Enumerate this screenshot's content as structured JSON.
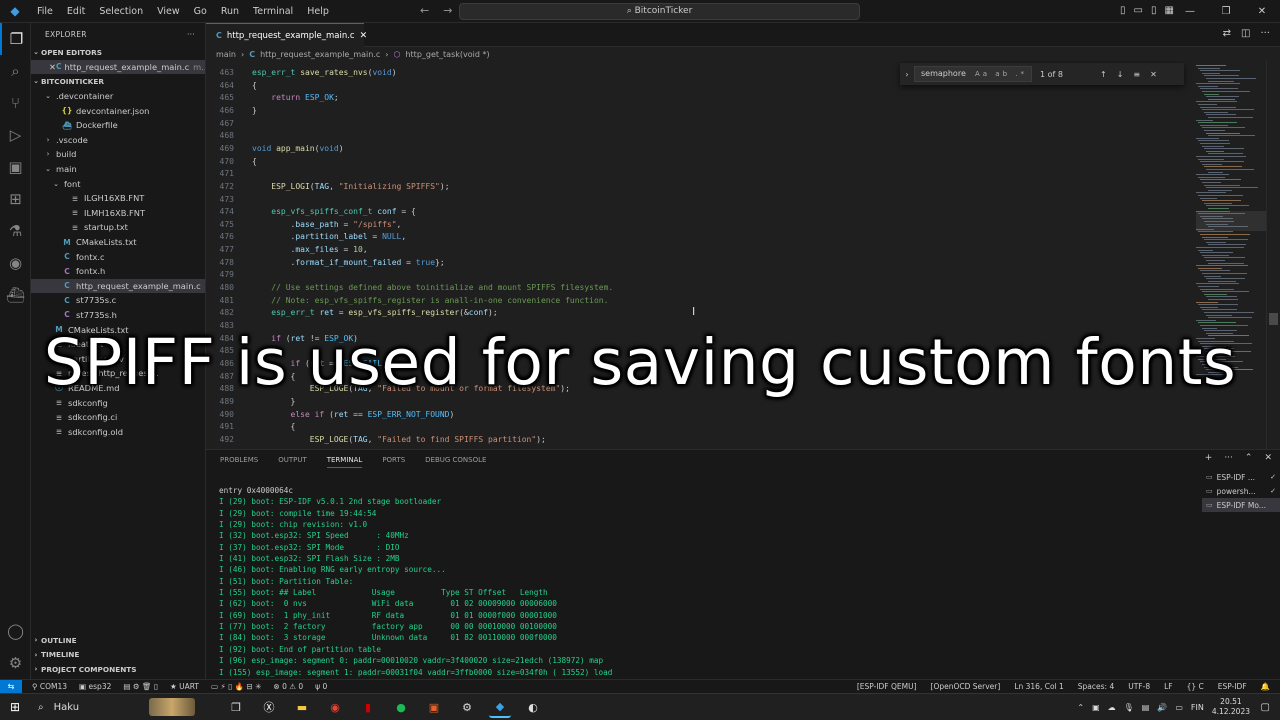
{
  "titlebar": {
    "menu": [
      "File",
      "Edit",
      "Selection",
      "View",
      "Go",
      "Run",
      "Terminal",
      "Help"
    ],
    "command_center": "BitcoinTicker"
  },
  "sidebar": {
    "title": "EXPLORER",
    "open_editors": "OPEN EDITORS",
    "open_editor_file": "http_request_example_main.c",
    "open_editor_suffix": "m...",
    "project": "BITCOINTICKER",
    "tree": [
      {
        "label": ".devcontainer",
        "type": "folder",
        "depth": 1,
        "open": true
      },
      {
        "label": "devcontainer.json",
        "type": "json",
        "depth": 2
      },
      {
        "label": "Dockerfile",
        "type": "docker",
        "depth": 2
      },
      {
        "label": ".vscode",
        "type": "folder",
        "depth": 1,
        "open": false
      },
      {
        "label": "build",
        "type": "folder",
        "depth": 1,
        "open": false
      },
      {
        "label": "main",
        "type": "folder",
        "depth": 1,
        "open": true
      },
      {
        "label": "font",
        "type": "folder",
        "depth": 2,
        "open": true
      },
      {
        "label": "ILGH16XB.FNT",
        "type": "txt",
        "depth": 3
      },
      {
        "label": "ILMH16XB.FNT",
        "type": "txt",
        "depth": 3
      },
      {
        "label": "startup.txt",
        "type": "txt",
        "depth": 3
      },
      {
        "label": "CMakeLists.txt",
        "type": "cmake",
        "depth": 2
      },
      {
        "label": "fontx.c",
        "type": "c",
        "depth": 2
      },
      {
        "label": "fontx.h",
        "type": "h",
        "depth": 2
      },
      {
        "label": "http_request_example_main.c",
        "type": "c",
        "depth": 2,
        "selected": true
      },
      {
        "label": "st7735s.c",
        "type": "c",
        "depth": 2
      },
      {
        "label": "st7735s.h",
        "type": "h",
        "depth": 2
      },
      {
        "label": "CMakeLists.txt",
        "type": "cmake",
        "depth": 1
      },
      {
        "label": "Ideat.txt",
        "type": "txt",
        "depth": 1
      },
      {
        "label": "partitions.csv",
        "type": "csv",
        "depth": 1
      },
      {
        "label": "pytest_http_request...",
        "type": "txt",
        "depth": 1
      },
      {
        "label": "README.md",
        "type": "md",
        "depth": 1
      },
      {
        "label": "sdkconfig",
        "type": "txt",
        "depth": 1
      },
      {
        "label": "sdkconfig.ci",
        "type": "txt",
        "depth": 1
      },
      {
        "label": "sdkconfig.old",
        "type": "txt",
        "depth": 1
      }
    ],
    "bottom_sections": [
      "OUTLINE",
      "TIMELINE",
      "PROJECT COMPONENTS"
    ]
  },
  "editor": {
    "tab_label": "http_request_example_main.c",
    "breadcrumb": [
      "main",
      "http_request_example_main.c",
      "http_get_task(void *)"
    ],
    "find": {
      "query": "semaphore",
      "count": "1 of 8",
      "options": "Aa ab .*"
    },
    "lines": [
      {
        "n": "463",
        "html": "<span class='ty'>esp_err_t</span> <span class='fn'>save_rates_nvs</span>(<span class='kw'>void</span>)"
      },
      {
        "n": "464",
        "html": "{"
      },
      {
        "n": "465",
        "html": "    <span class='ctl'>return</span> <span class='mac'>ESP_OK</span>;"
      },
      {
        "n": "466",
        "html": "}"
      },
      {
        "n": "467",
        "html": ""
      },
      {
        "n": "468",
        "html": ""
      },
      {
        "n": "469",
        "html": "<span class='kw'>void</span> <span class='fn'>app_main</span>(<span class='kw'>void</span>)"
      },
      {
        "n": "470",
        "html": "{"
      },
      {
        "n": "471",
        "html": ""
      },
      {
        "n": "472",
        "html": "    <span class='fn'>ESP_LOGI</span>(<span class='var'>TAG</span>, <span class='str'>\"Initializing SPIFFS\"</span>);"
      },
      {
        "n": "473",
        "html": ""
      },
      {
        "n": "474",
        "html": "    <span class='ty'>esp_vfs_spiffs_conf_t</span> <span class='var'>conf</span> = {"
      },
      {
        "n": "475",
        "html": "        .<span class='var'>base_path</span> = <span class='str'>\"/spiffs\"</span>,"
      },
      {
        "n": "476",
        "html": "        .<span class='var'>partition_label</span> = <span class='kw'>NULL</span>,"
      },
      {
        "n": "477",
        "html": "        .<span class='var'>max_files</span> = <span class='num'>10</span>,"
      },
      {
        "n": "478",
        "html": "        .<span class='var'>format_if_mount_failed</span> = <span class='kw'>true</span>};"
      },
      {
        "n": "479",
        "html": ""
      },
      {
        "n": "480",
        "html": "    <span class='cm'>// Use settings defined above toinitialize and mount SPIFFS filesystem.</span>"
      },
      {
        "n": "481",
        "html": "    <span class='cm'>// Note: esp_vfs_spiffs_register is anall-in-one convenience function.</span>"
      },
      {
        "n": "482",
        "html": "    <span class='ty'>esp_err_t</span> <span class='var'>ret</span> = <span class='fn'>esp_vfs_spiffs_register</span>(&amp;<span class='var'>conf</span>);"
      },
      {
        "n": "483",
        "html": ""
      },
      {
        "n": "484",
        "html": "    <span class='ctl'>if</span> (<span class='var'>ret</span> != <span class='mac'>ESP_OK</span>)"
      },
      {
        "n": "485",
        "html": "    {"
      },
      {
        "n": "486",
        "html": "        <span class='ctl'>if</span> (<span class='var'>ret</span> == <span class='mac'>ESP_FAIL</span>)"
      },
      {
        "n": "487",
        "html": "        {"
      },
      {
        "n": "488",
        "html": "            <span class='fn'>ESP_LOGE</span>(<span class='var'>TAG</span>, <span class='str'>\"Failed to mount or format filesystem\"</span>);"
      },
      {
        "n": "489",
        "html": "        }"
      },
      {
        "n": "490",
        "html": "        <span class='ctl'>else if</span> (<span class='var'>ret</span> == <span class='mac'>ESP_ERR_NOT_FOUND</span>)"
      },
      {
        "n": "491",
        "html": "        {"
      },
      {
        "n": "492",
        "html": "            <span class='fn'>ESP_LOGE</span>(<span class='var'>TAG</span>, <span class='str'>\"Failed to find SPIFFS partition\"</span>);"
      }
    ]
  },
  "panel": {
    "tabs": [
      "PROBLEMS",
      "OUTPUT",
      "TERMINAL",
      "PORTS",
      "DEBUG CONSOLE"
    ],
    "active_tab": "TERMINAL",
    "terminal_lines": [
      "entry 0x4000064c",
      "I (29) boot: ESP-IDF v5.0.1 2nd stage bootloader",
      "I (29) boot: compile time 19:44:54",
      "I (29) boot: chip revision: v1.0",
      "I (32) boot.esp32: SPI Speed      : 40MHz",
      "I (37) boot.esp32: SPI Mode       : DIO",
      "I (41) boot.esp32: SPI Flash Size : 2MB",
      "I (46) boot: Enabling RNG early entropy source...",
      "I (51) boot: Partition Table:",
      "I (55) boot: ## Label            Usage          Type ST Offset   Length",
      "I (62) boot:  0 nvs              WiFi data        01 02 00009000 00006000",
      "I (69) boot:  1 phy_init         RF data          01 01 0000f000 00001000",
      "I (77) boot:  2 factory          factory app      00 00 00010000 00100000",
      "I (84) boot:  3 storage          Unknown data     01 82 00110000 000f0000",
      "I (92) boot: End of partition table",
      "I (96) esp_image: segment 0: paddr=00010020 vaddr=3f400020 size=21edch (138972) map",
      "I (155) esp_image: segment 1: paddr=00031f04 vaddr=3ffb0000 size=034f0h ( 13552) load"
    ],
    "terminals": [
      "ESP-IDF ...",
      "powersh...",
      "ESP-IDF Mo..."
    ]
  },
  "statusbar": {
    "left": [
      "COM13",
      "esp32",
      "UART",
      "0 ⚠ 0",
      "0"
    ],
    "right": [
      "[ESP-IDF QEMU]",
      "[OpenOCD Server]",
      "Ln 316, Col 1",
      "Spaces: 4",
      "UTF-8",
      "LF",
      "{} C",
      "ESP-IDF"
    ]
  },
  "taskbar": {
    "search": "Haku",
    "lang": "FIN",
    "time": "20.51",
    "date": "4.12.2023"
  },
  "caption": "SPIFF is used for saving custom fonts"
}
